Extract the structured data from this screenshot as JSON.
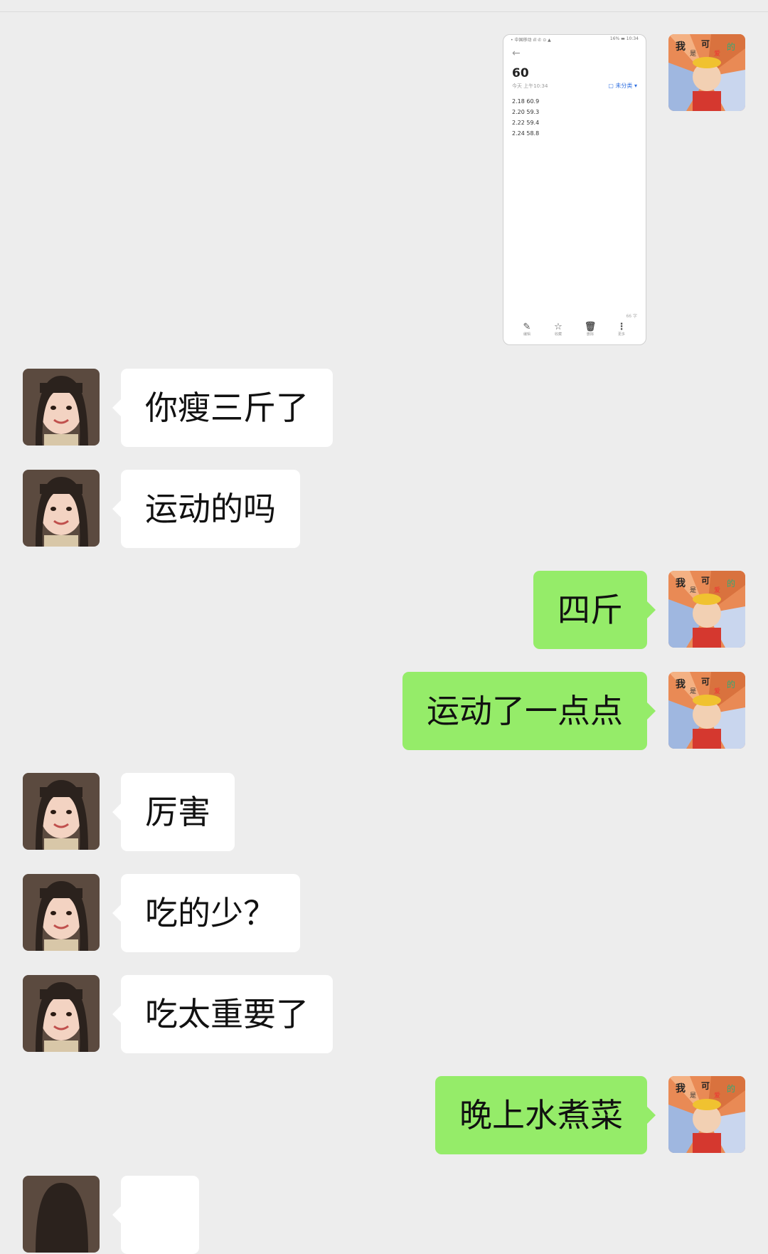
{
  "thumbnail": {
    "status_left": "• 中国移动 ıll ✆ ⊙ ▲",
    "status_right": "16% ▬ 10:34",
    "back_glyph": "←",
    "title": "60",
    "date": "今天 上午10:34",
    "label": "▢ 未分类 ▾",
    "lines": [
      "2.18 60.9",
      "2.20 59.3",
      "2.22 59.4",
      "2.24 58.8"
    ],
    "count": "66 字",
    "toolbar": [
      {
        "icon": "✎",
        "label": "编辑"
      },
      {
        "icon": "☆",
        "label": "收藏"
      },
      {
        "icon": "🗑",
        "label": "删除"
      },
      {
        "icon": "⋮",
        "label": "更多"
      }
    ]
  },
  "messages": [
    {
      "side": "in",
      "text": "你瘦三斤了"
    },
    {
      "side": "in",
      "text": "运动的吗"
    },
    {
      "side": "out",
      "text": "四斤"
    },
    {
      "side": "out",
      "text": "运动了一点点"
    },
    {
      "side": "in",
      "text": "厉害"
    },
    {
      "side": "in",
      "text": "吃的少？"
    },
    {
      "side": "in",
      "text": "吃太重要了"
    },
    {
      "side": "out",
      "text": "晚上水煮菜"
    }
  ],
  "self_avatar_text": [
    "我",
    "是",
    "可",
    "爱",
    "的"
  ],
  "colors": {
    "background": "#ededed",
    "outgoing_bubble": "#95ec69",
    "incoming_bubble": "#ffffff"
  }
}
